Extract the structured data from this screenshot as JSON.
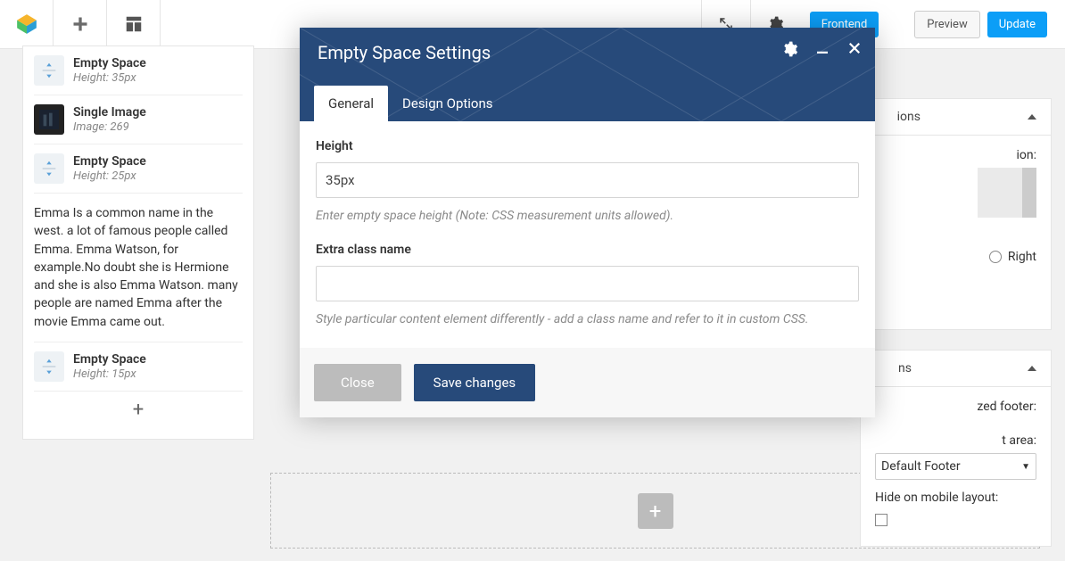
{
  "topbar": {
    "frontend": "Frontend",
    "preview": "Preview",
    "update": "Update"
  },
  "left": {
    "blocks": [
      {
        "title": "Empty Space",
        "sub": "Height: 35px"
      },
      {
        "title": "Single Image",
        "sub": "Image: 269"
      },
      {
        "title": "Empty Space",
        "sub": "Height: 25px"
      }
    ],
    "text": "Emma Is a common name in the west. a lot of famous people called Emma. Emma Watson, for example.No doubt she is Hermione and she is also Emma Watson. many people are named Emma after the movie Emma came out.",
    "block4": {
      "title": "Empty Space",
      "sub": "Height: 15px"
    }
  },
  "right": {
    "panel1": {
      "title_frag": "ions",
      "pos_frag": "ion:",
      "right": "Right"
    },
    "panel2": {
      "title_frag": "ns",
      "footer_lbl_frag": "zed footer:",
      "area_lbl_frag": "t area:",
      "select": "Default Footer",
      "hide": "Hide on mobile layout:"
    }
  },
  "modal": {
    "title": "Empty Space Settings",
    "tabs": {
      "general": "General",
      "design": "Design Options"
    },
    "height_label": "Height",
    "height_value": "35px",
    "height_hint": "Enter empty space height (Note: CSS measurement units allowed).",
    "class_label": "Extra class name",
    "class_value": "",
    "class_hint": "Style particular content element differently - add a class name and refer to it in custom CSS.",
    "close": "Close",
    "save": "Save changes"
  }
}
